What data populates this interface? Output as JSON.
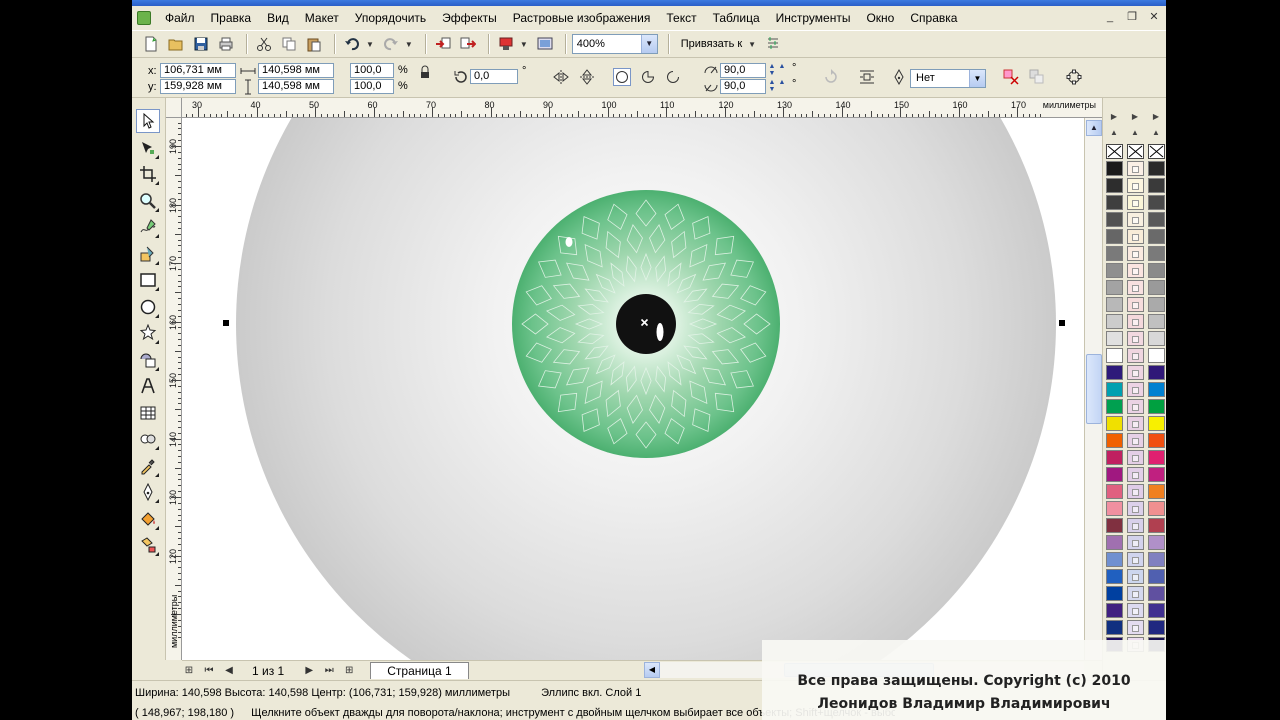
{
  "menu": {
    "items": [
      "Файл",
      "Правка",
      "Вид",
      "Макет",
      "Упорядочить",
      "Эффекты",
      "Растровые изображения",
      "Текст",
      "Таблица",
      "Инструменты",
      "Окно",
      "Справка"
    ]
  },
  "window_controls": {
    "minimize": "_",
    "restore": "❐",
    "close": "✕"
  },
  "toolbar": {
    "zoom_value": "400%",
    "snap_label": "Привязать к"
  },
  "property_bar": {
    "x_label": "x:",
    "y_label": "y:",
    "x_value": "106,731 мм",
    "y_value": "159,928 мм",
    "width_value": "140,598 мм",
    "height_value": "140,598 мм",
    "scale_x": "100,0",
    "scale_y": "100,0",
    "percent": "%",
    "rotation": "0,0",
    "arc_start": "90,0",
    "arc_end": "90,0",
    "degree": "°",
    "outline_value": "Нет"
  },
  "rulers": {
    "horizontal_labels": [
      "30",
      "40",
      "50",
      "60",
      "70",
      "80",
      "90",
      "100",
      "110",
      "120",
      "130",
      "140",
      "150",
      "160",
      "170"
    ],
    "horizontal_units": "миллиметры",
    "vertical_labels": [
      "190",
      "180",
      "170",
      "160",
      "150",
      "140",
      "130",
      "120"
    ],
    "vertical_units": "миллиметры"
  },
  "page_nav": {
    "page_count": "1 из 1",
    "page_tab": "Страница 1"
  },
  "palette": {
    "col1": [
      "#1a1a1a",
      "#2d2d2d",
      "#3f3f3f",
      "#525252",
      "#666666",
      "#7a7a7a",
      "#8f8f8f",
      "#a3a3a3",
      "#b8b8b8",
      "#cccccc",
      "#e0e0e0",
      "#ffffff",
      "#2e1a7a",
      "#00a0b0",
      "#00a050",
      "#f0e000",
      "#f06000",
      "#c02060",
      "#a01880",
      "#e06080",
      "#f090a0",
      "#803040",
      "#a070b0",
      "#7090d0",
      "#2060c0",
      "#0040a0",
      "#402080",
      "#103080",
      "#201060"
    ],
    "col2": [
      "#fbf0e6",
      "#fdf6e0",
      "#fbf6d8",
      "#f8f0e0",
      "#f8ecd8",
      "#faeae0",
      "#fae4e0",
      "#f8e0e0",
      "#f6dcdc",
      "#f4d8dc",
      "#f2d8e0",
      "#f0d6e0",
      "#eed4e2",
      "#ecd2e4",
      "#ead2e4",
      "#e8d0e4",
      "#e6d0e6",
      "#e4cee6",
      "#e2cee8",
      "#e0cce8",
      "#dcd0ea",
      "#d8d0ea",
      "#d4d2ec",
      "#d0d4ee",
      "#ccd6ee",
      "#d4d8ee",
      "#dcdaf0",
      "#e4dcf0",
      "#ecdcf0"
    ],
    "col3": [
      "#2a2a2a",
      "#3a3a3a",
      "#4a4a4a",
      "#5a5a5a",
      "#6a6a6a",
      "#7a7a7a",
      "#8a8a8a",
      "#9a9a9a",
      "#aaaaaa",
      "#c0c0c0",
      "#d8d8d8",
      "#ffffff",
      "#301878",
      "#0080d0",
      "#00a040",
      "#f8f000",
      "#f05010",
      "#e02070",
      "#c02080",
      "#f08020",
      "#f09090",
      "#b04050",
      "#b090c8",
      "#8080c0",
      "#5060b0",
      "#6050a0",
      "#403090",
      "#202880",
      "#181050"
    ]
  },
  "status": {
    "dimensions": "Ширина: 140,598 Высота: 140,598 Центр: (106,731; 159,928) миллиметры",
    "object_info": "Эллипс вкл. Слой 1",
    "cursor_coords": "( 148,967; 198,180 )",
    "hint": "Щелкните объект дважды для поворота/наклона; инструмент с двойным щелчком выбирает все объекты; Shift+щелчок - выбор нес"
  },
  "watermark": {
    "line1": "Все права защищены. Copyright (c) 2010",
    "line2": "Леонидов Владимир Владимирович"
  }
}
